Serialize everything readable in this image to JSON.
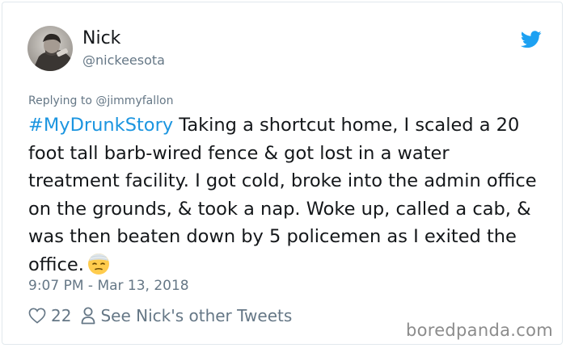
{
  "author": {
    "display_name": "Nick",
    "handle": "@nickeesota"
  },
  "reply_to": {
    "prefix": "Replying to ",
    "handle": "@jimmyfallon"
  },
  "tweet": {
    "hashtag": "#MyDrunkStory",
    "text": " Taking a shortcut home, I scaled a 20 foot tall barb-wired fence & got lost in a water treatment facility. I got cold, broke into the admin office on the grounds, & took a nap. Woke up, called a cab, & was then beaten down by 5 policemen as I exited the office.",
    "emoji": "face-with-head-bandage",
    "timestamp": "9:07 PM - Mar 13, 2018"
  },
  "actions": {
    "likes": "22",
    "other_tweets_label": "See Nick's other Tweets"
  },
  "watermark": "boredpanda.com",
  "colors": {
    "link": "#1b95e0",
    "twitter_blue": "#1da1f2",
    "secondary_text": "#657786",
    "primary_text": "#14171a"
  },
  "icons": [
    "twitter-bird-icon",
    "heart-icon",
    "person-icon",
    "bandaged-face-emoji"
  ]
}
